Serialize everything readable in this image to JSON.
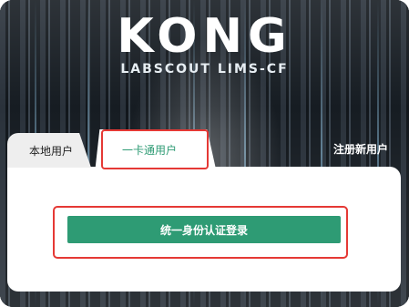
{
  "brand": {
    "logo": "KONG",
    "subtitle": "LABSCOUT LIMS-CF"
  },
  "tabs": [
    {
      "label": "本地用户",
      "active": false
    },
    {
      "label": "一卡通用户",
      "active": true
    }
  ],
  "register_link": "注册新用户",
  "sso_button_label": "统一身份认证登录",
  "colors": {
    "accent": "#2e9b74",
    "highlight": "#e53935"
  }
}
